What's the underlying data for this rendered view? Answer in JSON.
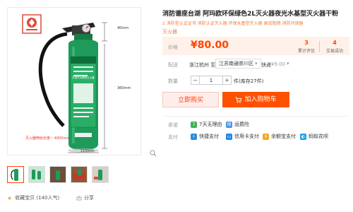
{
  "product": {
    "title": "消防谱座台湖 阿玛欧环保绿色2L灭火器夜光水基型灭火器干粉",
    "subtitle": "2 消防型认证证书 消防认证灭火器 环保水基型灭火器 高效阻燃 消防环保器",
    "subtitle2": "灭火器",
    "image_annotations": {
      "height_top": "40mm",
      "height_body": "360mm",
      "width_base": "110mm",
      "caption": "灭火器喷射长度~ 4000mm"
    },
    "can_text": "手提式水基型灭火器"
  },
  "price": {
    "label": "价格",
    "value": "¥80.00",
    "reviews_count": "3",
    "reviews_label": "累计评论",
    "sales_count": "4",
    "sales_label": "交易成功"
  },
  "shipping": {
    "label": "配送",
    "origin": "浙江杭州 至",
    "destination": "江苏南通崇川区",
    "method": "快递",
    "price": "¥9.00"
  },
  "quantity": {
    "label": "数量",
    "minus": "−",
    "value": "1",
    "plus": "+",
    "unit": "件(库存27件)"
  },
  "actions": {
    "buy": "立即购买",
    "cart": "加入购物车"
  },
  "services": {
    "commitment_label": "承诺",
    "commitment_items": [
      "7天无理由",
      "运费险"
    ],
    "payment_label": "支付",
    "payment_items": [
      "快捷支付",
      "信用卡支付",
      "余额宝支付",
      "蚂蚁花呗"
    ]
  },
  "footer": {
    "favorite": "收藏宝贝 (140人气)",
    "share": "分享"
  },
  "colors": {
    "accent": "#ff5000",
    "price": "#ff4400",
    "can_green": "#1e9b5a"
  }
}
